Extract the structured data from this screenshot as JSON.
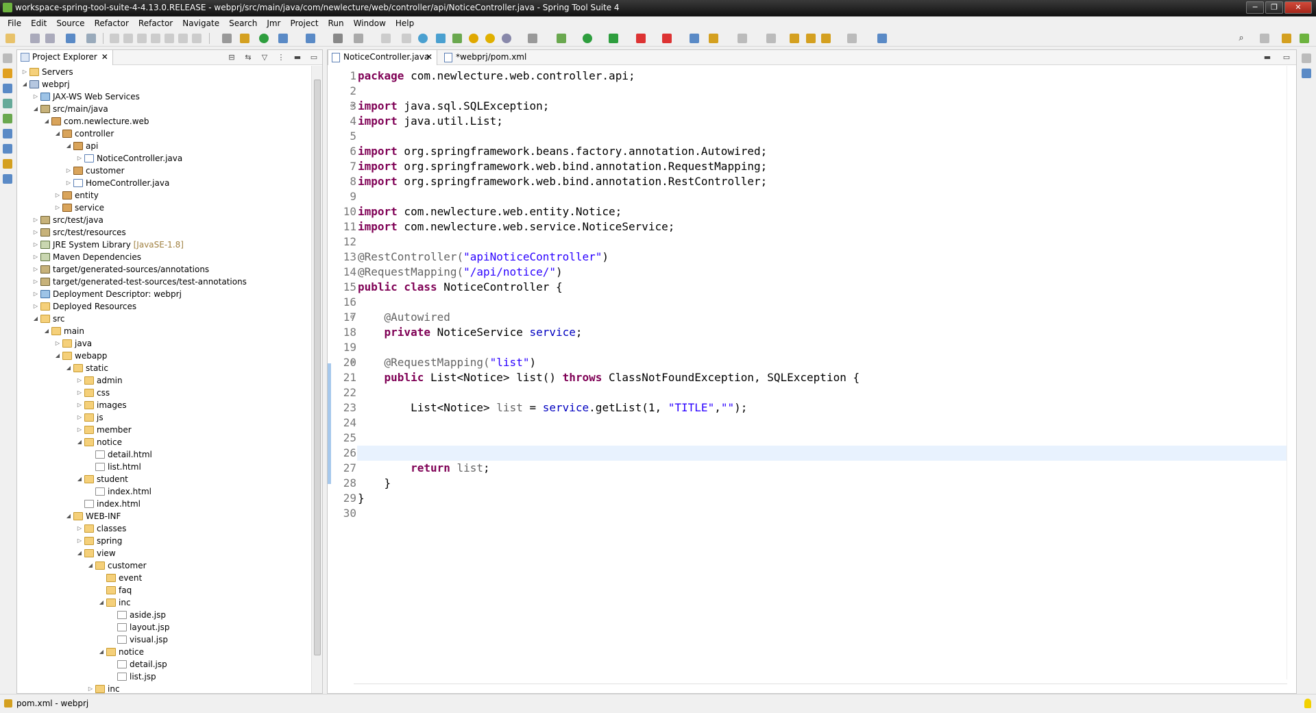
{
  "window": {
    "title": "workspace-spring-tool-suite-4-4.13.0.RELEASE - webprj/src/main/java/com/newlecture/web/controller/api/NoticeController.java - Spring Tool Suite 4",
    "controls": [
      "─",
      "❐",
      "✕"
    ]
  },
  "menubar": [
    "File",
    "Edit",
    "Source",
    "Refactor",
    "Refactor",
    "Navigate",
    "Search",
    "Jmr",
    "Project",
    "Run",
    "Window",
    "Help"
  ],
  "explorer": {
    "title": "Project Explorer",
    "close": "✕",
    "tree": [
      {
        "label": "Servers",
        "depth": 1,
        "icon": "folder",
        "tw": "▷"
      },
      {
        "label": "webprj",
        "depth": 1,
        "icon": "proj",
        "tw": "◢"
      },
      {
        "label": "JAX-WS Web Services",
        "depth": 2,
        "icon": "web",
        "tw": "▷"
      },
      {
        "label": "src/main/java",
        "depth": 2,
        "icon": "src",
        "tw": "◢"
      },
      {
        "label": "com.newlecture.web",
        "depth": 3,
        "icon": "pkg",
        "tw": "◢"
      },
      {
        "label": "controller",
        "depth": 4,
        "icon": "pkg",
        "tw": "◢"
      },
      {
        "label": "api",
        "depth": 5,
        "icon": "pkg",
        "tw": "◢"
      },
      {
        "label": "NoticeController.java",
        "depth": 6,
        "icon": "java",
        "tw": "▷"
      },
      {
        "label": "customer",
        "depth": 5,
        "icon": "pkg",
        "tw": "▷"
      },
      {
        "label": "HomeController.java",
        "depth": 5,
        "icon": "java",
        "tw": "▷"
      },
      {
        "label": "entity",
        "depth": 4,
        "icon": "pkg",
        "tw": "▷"
      },
      {
        "label": "service",
        "depth": 4,
        "icon": "pkg",
        "tw": "▷"
      },
      {
        "label": "src/test/java",
        "depth": 2,
        "icon": "src",
        "tw": "▷"
      },
      {
        "label": "src/test/resources",
        "depth": 2,
        "icon": "src",
        "tw": "▷"
      },
      {
        "label": "JRE System Library",
        "deco": "[JavaSE-1.8]",
        "depth": 2,
        "icon": "lib",
        "tw": "▷"
      },
      {
        "label": "Maven Dependencies",
        "depth": 2,
        "icon": "lib",
        "tw": "▷"
      },
      {
        "label": "target/generated-sources/annotations",
        "depth": 2,
        "icon": "src",
        "tw": "▷"
      },
      {
        "label": "target/generated-test-sources/test-annotations",
        "depth": 2,
        "icon": "src",
        "tw": "▷"
      },
      {
        "label": "Deployment Descriptor: webprj",
        "depth": 2,
        "icon": "web",
        "tw": "▷"
      },
      {
        "label": "Deployed Resources",
        "depth": 2,
        "icon": "folder",
        "tw": "▷"
      },
      {
        "label": "src",
        "depth": 2,
        "icon": "folder",
        "tw": "◢"
      },
      {
        "label": "main",
        "depth": 3,
        "icon": "folder",
        "tw": "◢"
      },
      {
        "label": "java",
        "depth": 4,
        "icon": "folder",
        "tw": "▷"
      },
      {
        "label": "webapp",
        "depth": 4,
        "icon": "folder",
        "tw": "◢"
      },
      {
        "label": "static",
        "depth": 5,
        "icon": "folder",
        "tw": "◢"
      },
      {
        "label": "admin",
        "depth": 6,
        "icon": "folder",
        "tw": "▷"
      },
      {
        "label": "css",
        "depth": 6,
        "icon": "folder",
        "tw": "▷"
      },
      {
        "label": "images",
        "depth": 6,
        "icon": "folder",
        "tw": "▷"
      },
      {
        "label": "js",
        "depth": 6,
        "icon": "folder",
        "tw": "▷"
      },
      {
        "label": "member",
        "depth": 6,
        "icon": "folder",
        "tw": "▷"
      },
      {
        "label": "notice",
        "depth": 6,
        "icon": "folder",
        "tw": "◢"
      },
      {
        "label": "detail.html",
        "depth": 7,
        "icon": "file",
        "tw": ""
      },
      {
        "label": "list.html",
        "depth": 7,
        "icon": "file",
        "tw": ""
      },
      {
        "label": "student",
        "depth": 6,
        "icon": "folder",
        "tw": "◢"
      },
      {
        "label": "index.html",
        "depth": 7,
        "icon": "file",
        "tw": ""
      },
      {
        "label": "index.html",
        "depth": 6,
        "icon": "file",
        "tw": ""
      },
      {
        "label": "WEB-INF",
        "depth": 5,
        "icon": "folder",
        "tw": "◢"
      },
      {
        "label": "classes",
        "depth": 6,
        "icon": "folder",
        "tw": "▷"
      },
      {
        "label": "spring",
        "depth": 6,
        "icon": "folder",
        "tw": "▷"
      },
      {
        "label": "view",
        "depth": 6,
        "icon": "folder",
        "tw": "◢"
      },
      {
        "label": "customer",
        "depth": 7,
        "icon": "folder",
        "tw": "◢"
      },
      {
        "label": "event",
        "depth": 8,
        "icon": "folder",
        "tw": ""
      },
      {
        "label": "faq",
        "depth": 8,
        "icon": "folder",
        "tw": ""
      },
      {
        "label": "inc",
        "depth": 8,
        "icon": "folder",
        "tw": "◢"
      },
      {
        "label": "aside.jsp",
        "depth": 9,
        "icon": "file",
        "tw": ""
      },
      {
        "label": "layout.jsp",
        "depth": 9,
        "icon": "file",
        "tw": ""
      },
      {
        "label": "visual.jsp",
        "depth": 9,
        "icon": "file",
        "tw": ""
      },
      {
        "label": "notice",
        "depth": 8,
        "icon": "folder",
        "tw": "◢"
      },
      {
        "label": "detail.jsp",
        "depth": 9,
        "icon": "file",
        "tw": ""
      },
      {
        "label": "list.jsp",
        "depth": 9,
        "icon": "file",
        "tw": ""
      },
      {
        "label": "inc",
        "depth": 7,
        "icon": "folder",
        "tw": "▷"
      }
    ]
  },
  "editor": {
    "tabs": [
      {
        "label": "NoticeController.java",
        "active": true,
        "close": "✕"
      },
      {
        "label": "*webprj/pom.xml",
        "active": false
      }
    ],
    "current_line": 26,
    "lines": [
      [
        [
          "kw",
          "package"
        ],
        [
          "t",
          " com.newlecture.web.controller.api;"
        ]
      ],
      [],
      [
        [
          "kw",
          "import"
        ],
        [
          "t",
          " java.sql.SQLException;"
        ]
      ],
      [
        [
          "kw",
          "import"
        ],
        [
          "t",
          " java.util.List;"
        ]
      ],
      [],
      [
        [
          "kw",
          "import"
        ],
        [
          "t",
          " org.springframework.beans.factory.annotation.Autowired;"
        ]
      ],
      [
        [
          "kw",
          "import"
        ],
        [
          "t",
          " org.springframework.web.bind.annotation.RequestMapping;"
        ]
      ],
      [
        [
          "kw",
          "import"
        ],
        [
          "t",
          " org.springframework.web.bind.annotation.RestController;"
        ]
      ],
      [],
      [
        [
          "kw",
          "import"
        ],
        [
          "t",
          " com.newlecture.web.entity.Notice;"
        ]
      ],
      [
        [
          "kw",
          "import"
        ],
        [
          "t",
          " com.newlecture.web.service.NoticeService;"
        ]
      ],
      [],
      [
        [
          "ann",
          "@RestController("
        ],
        [
          "str",
          "\"apiNoticeController\""
        ],
        [
          "t",
          ")"
        ]
      ],
      [
        [
          "ann",
          "@RequestMapping("
        ],
        [
          "str",
          "\"/api/notice/\""
        ],
        [
          "t",
          ")"
        ]
      ],
      [
        [
          "kw",
          "public class"
        ],
        [
          "t",
          " NoticeController {"
        ]
      ],
      [],
      [
        [
          "t",
          "    "
        ],
        [
          "ann",
          "@Autowired"
        ]
      ],
      [
        [
          "t",
          "    "
        ],
        [
          "kw",
          "private"
        ],
        [
          "t",
          " NoticeService "
        ],
        [
          "fld",
          "service"
        ],
        [
          "t",
          ";"
        ]
      ],
      [],
      [
        [
          "t",
          "    "
        ],
        [
          "ann",
          "@RequestMapping("
        ],
        [
          "str",
          "\"list\""
        ],
        [
          "t",
          ")"
        ]
      ],
      [
        [
          "t",
          "    "
        ],
        [
          "kw",
          "public"
        ],
        [
          "t",
          " List<Notice> list() "
        ],
        [
          "kw",
          "throws"
        ],
        [
          "t",
          " ClassNotFoundException, SQLException {"
        ]
      ],
      [],
      [
        [
          "t",
          "        List<Notice> "
        ],
        [
          "ann",
          "list"
        ],
        [
          "t",
          " = "
        ],
        [
          "fld",
          "service"
        ],
        [
          "t",
          ".getList(1, "
        ],
        [
          "str",
          "\"TITLE\""
        ],
        [
          "t",
          ","
        ],
        [
          "str",
          "\"\""
        ],
        [
          "t",
          ");"
        ]
      ],
      [],
      [],
      [],
      [
        [
          "t",
          "        "
        ],
        [
          "kw",
          "return"
        ],
        [
          "t",
          " "
        ],
        [
          "ann",
          "list"
        ],
        [
          "t",
          ";"
        ]
      ],
      [
        [
          "t",
          "    }"
        ]
      ],
      [
        [
          "t",
          "}"
        ]
      ],
      []
    ],
    "fold_markers": {
      "3": "⊖",
      "17": "⊖",
      "20": "⊖"
    }
  },
  "status": {
    "text": "pom.xml - webprj"
  }
}
